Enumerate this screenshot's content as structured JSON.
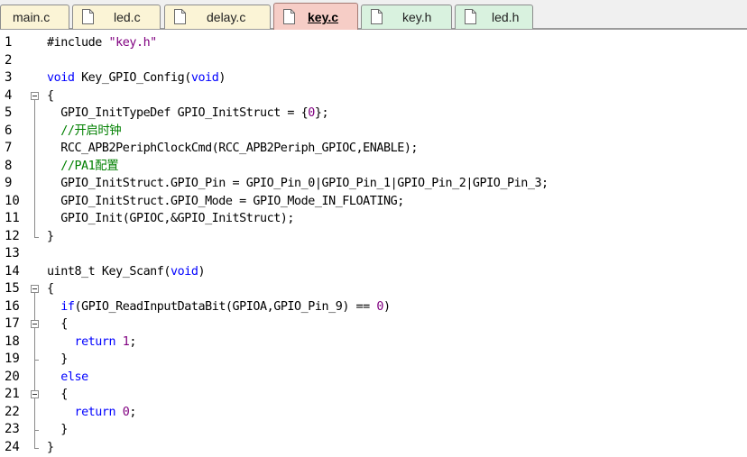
{
  "tabs": [
    {
      "label": "main.c",
      "type": "c",
      "active": false,
      "icon": false
    },
    {
      "label": "led.c",
      "type": "c",
      "active": false,
      "icon": true
    },
    {
      "label": "delay.c",
      "type": "c",
      "active": false,
      "icon": true
    },
    {
      "label": "key.c",
      "type": "c",
      "active": true,
      "icon": true
    },
    {
      "label": "key.h",
      "type": "h",
      "active": false,
      "icon": true
    },
    {
      "label": "led.h",
      "type": "h",
      "active": false,
      "icon": true
    }
  ],
  "colors": {
    "keyword": "#0000ff",
    "string": "#800080",
    "number": "#800080",
    "comment": "#008000",
    "active_tab": "#f6cdc6",
    "c_tab": "#fbf4d6",
    "h_tab": "#d9f2df"
  },
  "fold_markers": [
    4,
    15,
    17,
    21
  ],
  "code_lines": [
    {
      "n": "1",
      "parts": [
        [
          "pp",
          "#include "
        ],
        [
          "str",
          "\"key.h\""
        ]
      ]
    },
    {
      "n": "2",
      "parts": []
    },
    {
      "n": "3",
      "parts": [
        [
          "kw",
          "void"
        ],
        [
          "",
          " Key_GPIO_Config("
        ],
        [
          "kw",
          "void"
        ],
        [
          "",
          ")"
        ]
      ]
    },
    {
      "n": "4",
      "parts": [
        [
          "",
          "{"
        ]
      ]
    },
    {
      "n": "5",
      "parts": [
        [
          "",
          "  GPIO_InitTypeDef GPIO_InitStruct = {"
        ],
        [
          "num",
          "0"
        ],
        [
          "",
          "};"
        ]
      ]
    },
    {
      "n": "6",
      "parts": [
        [
          "cmt",
          "  //开启时钟"
        ]
      ]
    },
    {
      "n": "7",
      "parts": [
        [
          "",
          "  RCC_APB2PeriphClockCmd(RCC_APB2Periph_GPIOC,ENABLE);"
        ]
      ]
    },
    {
      "n": "8",
      "parts": [
        [
          "cmt",
          "  //PA1配置"
        ]
      ]
    },
    {
      "n": "9",
      "parts": [
        [
          "",
          "  GPIO_InitStruct.GPIO_Pin = GPIO_Pin_0|GPIO_Pin_1|GPIO_Pin_2|GPIO_Pin_3;"
        ]
      ]
    },
    {
      "n": "10",
      "parts": [
        [
          "",
          "  GPIO_InitStruct.GPIO_Mode = GPIO_Mode_IN_FLOATING;"
        ]
      ]
    },
    {
      "n": "11",
      "parts": [
        [
          "",
          "  GPIO_Init(GPIOC,&GPIO_InitStruct);"
        ]
      ]
    },
    {
      "n": "12",
      "parts": [
        [
          "",
          "}"
        ]
      ]
    },
    {
      "n": "13",
      "parts": []
    },
    {
      "n": "14",
      "parts": [
        [
          "",
          "uint8_t Key_Scanf("
        ],
        [
          "kw",
          "void"
        ],
        [
          "",
          ")"
        ]
      ]
    },
    {
      "n": "15",
      "parts": [
        [
          "",
          "{"
        ]
      ]
    },
    {
      "n": "16",
      "parts": [
        [
          "",
          "  "
        ],
        [
          "kw",
          "if"
        ],
        [
          "",
          "(GPIO_ReadInputDataBit(GPIOA,GPIO_Pin_9) == "
        ],
        [
          "num",
          "0"
        ],
        [
          "",
          ")"
        ]
      ]
    },
    {
      "n": "17",
      "parts": [
        [
          "",
          "  {"
        ]
      ]
    },
    {
      "n": "18",
      "parts": [
        [
          "",
          "    "
        ],
        [
          "kw",
          "return"
        ],
        [
          "",
          " "
        ],
        [
          "num",
          "1"
        ],
        [
          "",
          ";"
        ]
      ]
    },
    {
      "n": "19",
      "parts": [
        [
          "",
          "  }"
        ]
      ]
    },
    {
      "n": "20",
      "parts": [
        [
          "",
          "  "
        ],
        [
          "kw",
          "else"
        ]
      ]
    },
    {
      "n": "21",
      "parts": [
        [
          "",
          "  {"
        ]
      ]
    },
    {
      "n": "22",
      "parts": [
        [
          "",
          "    "
        ],
        [
          "kw",
          "return"
        ],
        [
          "",
          " "
        ],
        [
          "num",
          "0"
        ],
        [
          "",
          ";"
        ]
      ]
    },
    {
      "n": "23",
      "parts": [
        [
          "",
          "  }"
        ]
      ]
    },
    {
      "n": "24",
      "parts": [
        [
          "",
          "}"
        ]
      ]
    }
  ]
}
